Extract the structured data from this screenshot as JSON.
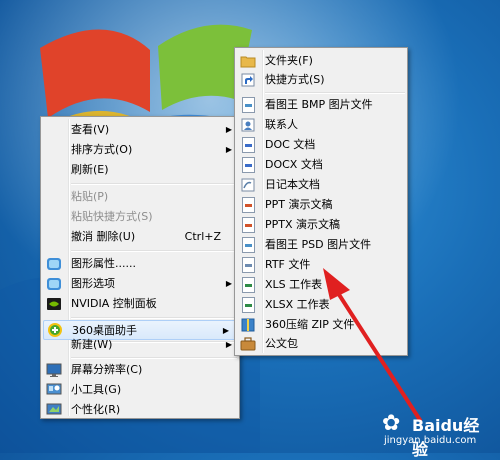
{
  "desktop": {
    "background": "#1a6fb8"
  },
  "context_menu": {
    "items": [
      {
        "label": "查看(V)",
        "submenu": true
      },
      {
        "label": "排序方式(O)",
        "submenu": true
      },
      {
        "label": "刷新(E)"
      },
      {
        "label": "粘贴(P)",
        "disabled": true
      },
      {
        "label": "粘贴快捷方式(S)",
        "disabled": true
      },
      {
        "label": "撤消 删除(U)",
        "shortcut": "Ctrl+Z"
      },
      {
        "label": "图形属性......",
        "icon": "intel-graphics-icon"
      },
      {
        "label": "图形选项",
        "icon": "intel-graphics-icon",
        "submenu": true
      },
      {
        "label": "NVIDIA 控制面板",
        "icon": "nvidia-icon"
      },
      {
        "label": "360桌面助手",
        "icon": "360-icon",
        "submenu": true,
        "highlighted": true
      },
      {
        "label": "新建(W)",
        "submenu": true
      },
      {
        "label": "屏幕分辨率(C)",
        "icon": "monitor-icon"
      },
      {
        "label": "小工具(G)",
        "icon": "gadgets-icon"
      },
      {
        "label": "个性化(R)",
        "icon": "personalize-icon"
      }
    ]
  },
  "new_submenu": {
    "items": [
      {
        "label": "文件夹(F)",
        "icon": "folder-icon"
      },
      {
        "label": "快捷方式(S)",
        "icon": "shortcut-icon"
      },
      {
        "label": "看图王 BMP 图片文件",
        "icon": "bmp-file-icon"
      },
      {
        "label": "联系人",
        "icon": "contact-icon"
      },
      {
        "label": "DOC 文档",
        "icon": "doc-file-icon"
      },
      {
        "label": "DOCX 文档",
        "icon": "docx-file-icon"
      },
      {
        "label": "日记本文档",
        "icon": "journal-file-icon"
      },
      {
        "label": "PPT 演示文稿",
        "icon": "ppt-file-icon"
      },
      {
        "label": "PPTX 演示文稿",
        "icon": "pptx-file-icon"
      },
      {
        "label": "看图王 PSD 图片文件",
        "icon": "psd-file-icon"
      },
      {
        "label": "RTF 文件",
        "icon": "rtf-file-icon"
      },
      {
        "label": "XLS 工作表",
        "icon": "xls-file-icon"
      },
      {
        "label": "XLSX 工作表",
        "icon": "xlsx-file-icon"
      },
      {
        "label": "360压缩 ZIP 文件",
        "icon": "zip-file-icon"
      },
      {
        "label": "公文包",
        "icon": "briefcase-icon"
      }
    ]
  },
  "watermark": {
    "name": "Baidu经验",
    "url": "jingyan.baidu.com"
  },
  "annotation": {
    "color": "#e02020"
  }
}
